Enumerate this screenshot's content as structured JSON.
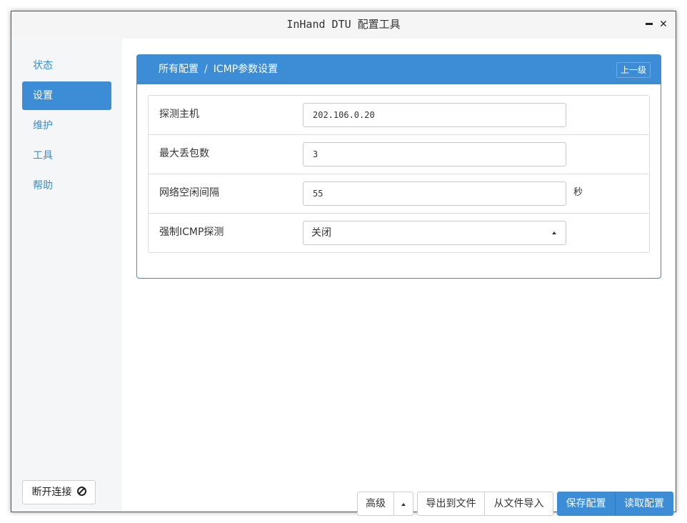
{
  "window": {
    "title": "InHand DTU 配置工具"
  },
  "sidebar": {
    "items": [
      {
        "label": "状态",
        "active": false
      },
      {
        "label": "设置",
        "active": true
      },
      {
        "label": "维护",
        "active": false
      },
      {
        "label": "工具",
        "active": false
      },
      {
        "label": "帮助",
        "active": false
      }
    ],
    "disconnect_label": "断开连接",
    "disconnect_icon": "ban-icon"
  },
  "panel": {
    "breadcrumb_root": "所有配置",
    "breadcrumb_sep": "/",
    "breadcrumb_current": "ICMP参数设置",
    "up_button": "上一级"
  },
  "form": {
    "probe_host_label": "探测主机",
    "probe_host_value": "202.106.0.20",
    "max_loss_label": "最大丢包数",
    "max_loss_value": "3",
    "idle_interval_label": "网络空闲间隔",
    "idle_interval_value": "55",
    "idle_interval_unit": "秒",
    "force_icmp_label": "强制ICMP探测",
    "force_icmp_value": "关闭"
  },
  "footer": {
    "advanced": "高级",
    "export": "导出到文件",
    "import": "从文件导入",
    "save": "保存配置",
    "read": "读取配置"
  },
  "colors": {
    "accent": "#3c8dd5",
    "link": "#3a8ccc"
  }
}
